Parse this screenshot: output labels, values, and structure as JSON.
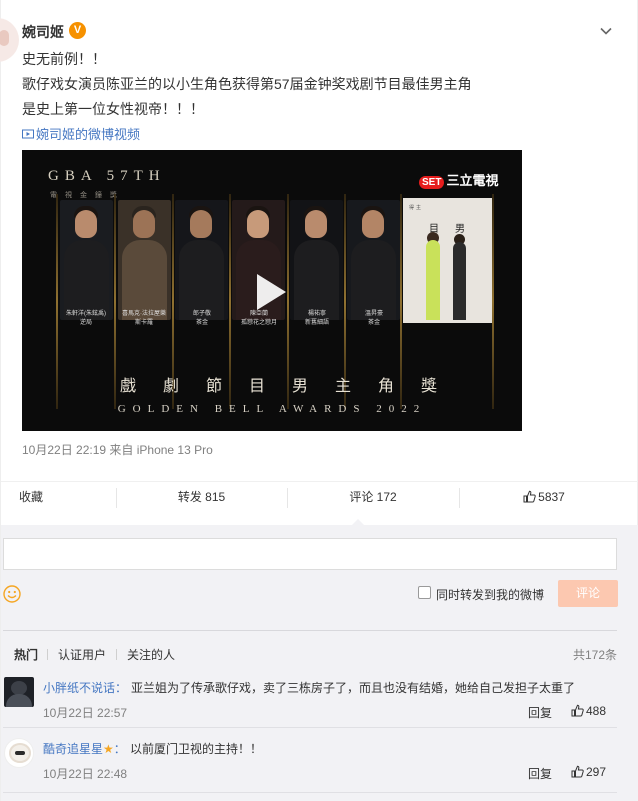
{
  "post": {
    "username": "婉司姬",
    "verified_badge": "V",
    "lines": [
      "史无前例！！",
      "歌仔戏女演员陈亚兰的以小生角色获得第57届金钟奖戏剧节目最佳男主角",
      "是史上第一位女性视帝！！！"
    ],
    "video_link": "婉司姬的微博视频",
    "meta": "10月22日 22:19  来自 iPhone 13 Pro"
  },
  "video": {
    "gba_logo": "GBA 57TH",
    "gba_sub": "電視金鐘獎",
    "channel": "三立電視",
    "channel_logo": "SET",
    "title_cn": "戲劇節目男主角獎",
    "title_en": "GOLDEN BELL AWARDS 2022",
    "nominees": [
      {
        "name": "朱軒洋(朱鉉禹)",
        "role": "逆局"
      },
      {
        "name": "喜馬克·法拉屋樂",
        "role": "斯卡羅"
      },
      {
        "name": "郎子敬",
        "role": "茶金"
      },
      {
        "name": "陳亞蘭",
        "role": "孤戀花之戀月"
      },
      {
        "name": "楊祐寧",
        "role": "新舊細語"
      },
      {
        "name": "溫昇豪",
        "role": "茶金"
      }
    ],
    "winner_panel": {
      "label": "得主",
      "big_left": "目",
      "big_right": "男"
    }
  },
  "actions": {
    "favorite": "收藏",
    "forward": "转发 815",
    "comment": "评论 172",
    "like": "5837"
  },
  "composer": {
    "input_value": "",
    "also_forward": "同时转发到我的微博",
    "submit": "评论"
  },
  "comments_header": {
    "tabs": [
      "热门",
      "认证用户",
      "关注的人"
    ],
    "total": "共172条"
  },
  "comments": [
    {
      "user": "小胖纸不说话",
      "sep": "：",
      "text": "亚兰姐为了传承歌仔戏，卖了三栋房子了，而且也没有结婚，她给自己发担子太重了",
      "time": "10月22日 22:57",
      "reply": "回复",
      "likes": "488"
    },
    {
      "user": "酷奇追星星",
      "sep": "：",
      "text": "以前厦门卫视的主持！！",
      "time": "10月22日 22:48",
      "reply": "回复",
      "likes": "297"
    }
  ],
  "colors": {
    "link": "#4577c2",
    "badge": "#f69100",
    "submit_disabled": "#fcc8b0",
    "comment_bg": "#f2f2f5"
  }
}
